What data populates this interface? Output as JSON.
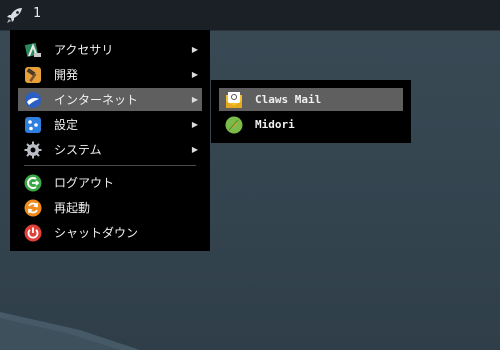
{
  "panel": {
    "launcher_icon": "rocket-icon",
    "workspace": "1"
  },
  "main_menu": {
    "items": [
      {
        "label": "アクセサリ",
        "icon": "accessories-icon",
        "submenu": true
      },
      {
        "label": "開発",
        "icon": "hammer-icon",
        "submenu": true
      },
      {
        "label": "インターネット",
        "icon": "globe-icon",
        "submenu": true,
        "selected": true
      },
      {
        "label": "設定",
        "icon": "settings-icon",
        "submenu": true
      },
      {
        "label": "システム",
        "icon": "gear-icon",
        "submenu": true
      },
      {
        "label": "ログアウト",
        "icon": "logout-icon",
        "submenu": false
      },
      {
        "label": "再起動",
        "icon": "restart-icon",
        "submenu": false
      },
      {
        "label": "シャットダウン",
        "icon": "power-icon",
        "submenu": false
      }
    ],
    "arrow": "▶"
  },
  "internet_submenu": {
    "items": [
      {
        "label": "Claws Mail",
        "icon": "mail-icon",
        "selected": true
      },
      {
        "label": "Midori",
        "icon": "browser-icon",
        "selected": false
      }
    ]
  },
  "colors": {
    "menu_bg": "#000000",
    "selected_bg": "#5f5f5f",
    "panel_bg": "#1a2026",
    "desktop_bg": "#3a4a55"
  }
}
